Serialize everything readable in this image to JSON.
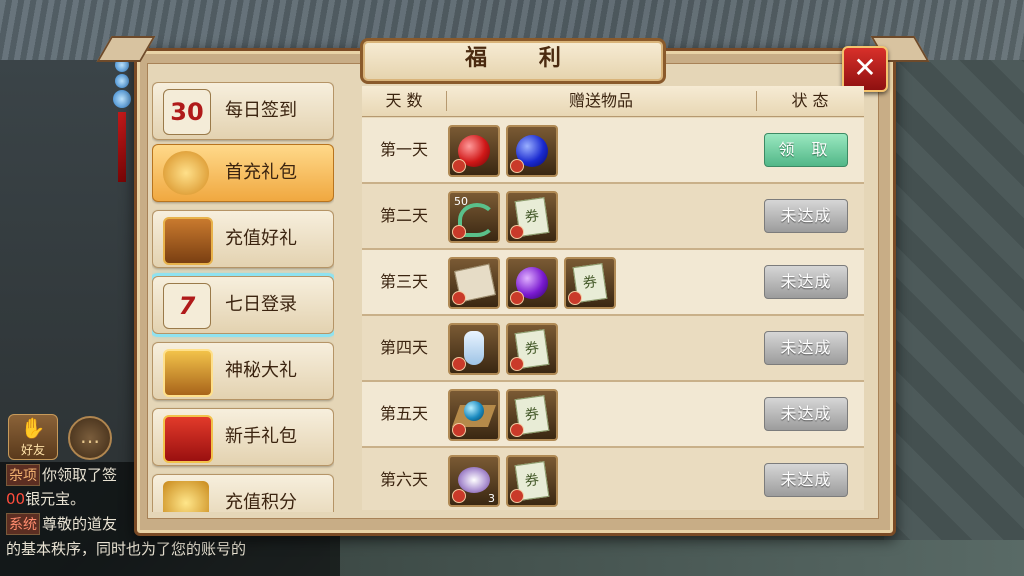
{
  "window": {
    "title": "福 利",
    "close_glyph": "✕"
  },
  "tabs": [
    {
      "label": "每日签到",
      "icon": "calendar-30-icon",
      "icon_text": "30"
    },
    {
      "label": "首充礼包",
      "icon": "money-bag-icon",
      "icon_text": ""
    },
    {
      "label": "充值好礼",
      "icon": "treasure-chest-icon",
      "icon_text": ""
    },
    {
      "label": "七日登录",
      "icon": "calendar-7-icon",
      "icon_text": "7"
    },
    {
      "label": "神秘大礼",
      "icon": "golden-chest-icon",
      "icon_text": ""
    },
    {
      "label": "新手礼包",
      "icon": "gift-box-icon",
      "icon_text": ""
    },
    {
      "label": "充值积分",
      "icon": "gold-pile-icon",
      "icon_text": ""
    }
  ],
  "active_tab": "首充礼包",
  "selected_tab": "七日登录",
  "table": {
    "headers": {
      "day": "天 数",
      "items": "赠送物品",
      "status": "状 态"
    },
    "rows": [
      {
        "day": "第一天",
        "items": [
          {
            "icon": "red-orb-icon"
          },
          {
            "icon": "blue-orb-icon"
          }
        ],
        "status": "领 取",
        "claimable": true
      },
      {
        "day": "第二天",
        "items": [
          {
            "icon": "green-pendant-icon",
            "count": "50"
          },
          {
            "icon": "voucher-icon",
            "text": "券"
          }
        ],
        "status": "未达成",
        "claimable": false
      },
      {
        "day": "第三天",
        "items": [
          {
            "icon": "scroll-icon"
          },
          {
            "icon": "purple-orb-icon"
          },
          {
            "icon": "voucher-icon",
            "text": "券"
          }
        ],
        "status": "未达成",
        "claimable": false
      },
      {
        "day": "第四天",
        "items": [
          {
            "icon": "porcelain-vase-icon"
          },
          {
            "icon": "voucher-icon",
            "text": "券"
          }
        ],
        "status": "未达成",
        "claimable": false
      },
      {
        "day": "第五天",
        "items": [
          {
            "icon": "compass-orb-icon"
          },
          {
            "icon": "voucher-icon",
            "text": "券"
          }
        ],
        "status": "未达成",
        "claimable": false
      },
      {
        "day": "第六天",
        "items": [
          {
            "icon": "spirit-stone-icon",
            "count": "3"
          },
          {
            "icon": "voucher-icon",
            "text": "券"
          }
        ],
        "status": "未达成",
        "claimable": false
      }
    ]
  },
  "side": {
    "friend_label": "好友"
  },
  "chat": {
    "lines": [
      {
        "tag": "杂项",
        "text": "你领取了签",
        "sys": false
      },
      {
        "tag": "",
        "prefix": "00",
        "text": "银元宝。",
        "sys": false
      },
      {
        "tag": "系统",
        "text": "尊敬的道友",
        "sys": true
      },
      {
        "tag": "",
        "text": "的基本秩序，同时也为了您的账号的",
        "sys": false
      }
    ]
  },
  "colors": {
    "claim_button": "#52b788",
    "locked_button": "#9c9c9c",
    "active_tab": "#f0a840",
    "close_button": "#c21e1e"
  }
}
